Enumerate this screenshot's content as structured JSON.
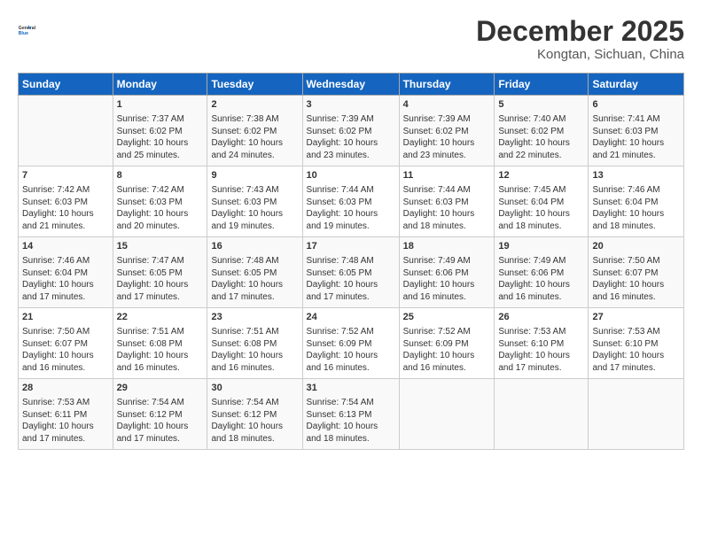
{
  "header": {
    "logo_general": "General",
    "logo_blue": "Blue",
    "month": "December 2025",
    "location": "Kongtan, Sichuan, China"
  },
  "weekdays": [
    "Sunday",
    "Monday",
    "Tuesday",
    "Wednesday",
    "Thursday",
    "Friday",
    "Saturday"
  ],
  "weeks": [
    [
      {
        "day": "",
        "info": ""
      },
      {
        "day": "1",
        "info": "Sunrise: 7:37 AM\nSunset: 6:02 PM\nDaylight: 10 hours\nand 25 minutes."
      },
      {
        "day": "2",
        "info": "Sunrise: 7:38 AM\nSunset: 6:02 PM\nDaylight: 10 hours\nand 24 minutes."
      },
      {
        "day": "3",
        "info": "Sunrise: 7:39 AM\nSunset: 6:02 PM\nDaylight: 10 hours\nand 23 minutes."
      },
      {
        "day": "4",
        "info": "Sunrise: 7:39 AM\nSunset: 6:02 PM\nDaylight: 10 hours\nand 23 minutes."
      },
      {
        "day": "5",
        "info": "Sunrise: 7:40 AM\nSunset: 6:02 PM\nDaylight: 10 hours\nand 22 minutes."
      },
      {
        "day": "6",
        "info": "Sunrise: 7:41 AM\nSunset: 6:03 PM\nDaylight: 10 hours\nand 21 minutes."
      }
    ],
    [
      {
        "day": "7",
        "info": "Sunrise: 7:42 AM\nSunset: 6:03 PM\nDaylight: 10 hours\nand 21 minutes."
      },
      {
        "day": "8",
        "info": "Sunrise: 7:42 AM\nSunset: 6:03 PM\nDaylight: 10 hours\nand 20 minutes."
      },
      {
        "day": "9",
        "info": "Sunrise: 7:43 AM\nSunset: 6:03 PM\nDaylight: 10 hours\nand 19 minutes."
      },
      {
        "day": "10",
        "info": "Sunrise: 7:44 AM\nSunset: 6:03 PM\nDaylight: 10 hours\nand 19 minutes."
      },
      {
        "day": "11",
        "info": "Sunrise: 7:44 AM\nSunset: 6:03 PM\nDaylight: 10 hours\nand 18 minutes."
      },
      {
        "day": "12",
        "info": "Sunrise: 7:45 AM\nSunset: 6:04 PM\nDaylight: 10 hours\nand 18 minutes."
      },
      {
        "day": "13",
        "info": "Sunrise: 7:46 AM\nSunset: 6:04 PM\nDaylight: 10 hours\nand 18 minutes."
      }
    ],
    [
      {
        "day": "14",
        "info": "Sunrise: 7:46 AM\nSunset: 6:04 PM\nDaylight: 10 hours\nand 17 minutes."
      },
      {
        "day": "15",
        "info": "Sunrise: 7:47 AM\nSunset: 6:05 PM\nDaylight: 10 hours\nand 17 minutes."
      },
      {
        "day": "16",
        "info": "Sunrise: 7:48 AM\nSunset: 6:05 PM\nDaylight: 10 hours\nand 17 minutes."
      },
      {
        "day": "17",
        "info": "Sunrise: 7:48 AM\nSunset: 6:05 PM\nDaylight: 10 hours\nand 17 minutes."
      },
      {
        "day": "18",
        "info": "Sunrise: 7:49 AM\nSunset: 6:06 PM\nDaylight: 10 hours\nand 16 minutes."
      },
      {
        "day": "19",
        "info": "Sunrise: 7:49 AM\nSunset: 6:06 PM\nDaylight: 10 hours\nand 16 minutes."
      },
      {
        "day": "20",
        "info": "Sunrise: 7:50 AM\nSunset: 6:07 PM\nDaylight: 10 hours\nand 16 minutes."
      }
    ],
    [
      {
        "day": "21",
        "info": "Sunrise: 7:50 AM\nSunset: 6:07 PM\nDaylight: 10 hours\nand 16 minutes."
      },
      {
        "day": "22",
        "info": "Sunrise: 7:51 AM\nSunset: 6:08 PM\nDaylight: 10 hours\nand 16 minutes."
      },
      {
        "day": "23",
        "info": "Sunrise: 7:51 AM\nSunset: 6:08 PM\nDaylight: 10 hours\nand 16 minutes."
      },
      {
        "day": "24",
        "info": "Sunrise: 7:52 AM\nSunset: 6:09 PM\nDaylight: 10 hours\nand 16 minutes."
      },
      {
        "day": "25",
        "info": "Sunrise: 7:52 AM\nSunset: 6:09 PM\nDaylight: 10 hours\nand 16 minutes."
      },
      {
        "day": "26",
        "info": "Sunrise: 7:53 AM\nSunset: 6:10 PM\nDaylight: 10 hours\nand 17 minutes."
      },
      {
        "day": "27",
        "info": "Sunrise: 7:53 AM\nSunset: 6:10 PM\nDaylight: 10 hours\nand 17 minutes."
      }
    ],
    [
      {
        "day": "28",
        "info": "Sunrise: 7:53 AM\nSunset: 6:11 PM\nDaylight: 10 hours\nand 17 minutes."
      },
      {
        "day": "29",
        "info": "Sunrise: 7:54 AM\nSunset: 6:12 PM\nDaylight: 10 hours\nand 17 minutes."
      },
      {
        "day": "30",
        "info": "Sunrise: 7:54 AM\nSunset: 6:12 PM\nDaylight: 10 hours\nand 18 minutes."
      },
      {
        "day": "31",
        "info": "Sunrise: 7:54 AM\nSunset: 6:13 PM\nDaylight: 10 hours\nand 18 minutes."
      },
      {
        "day": "",
        "info": ""
      },
      {
        "day": "",
        "info": ""
      },
      {
        "day": "",
        "info": ""
      }
    ]
  ]
}
